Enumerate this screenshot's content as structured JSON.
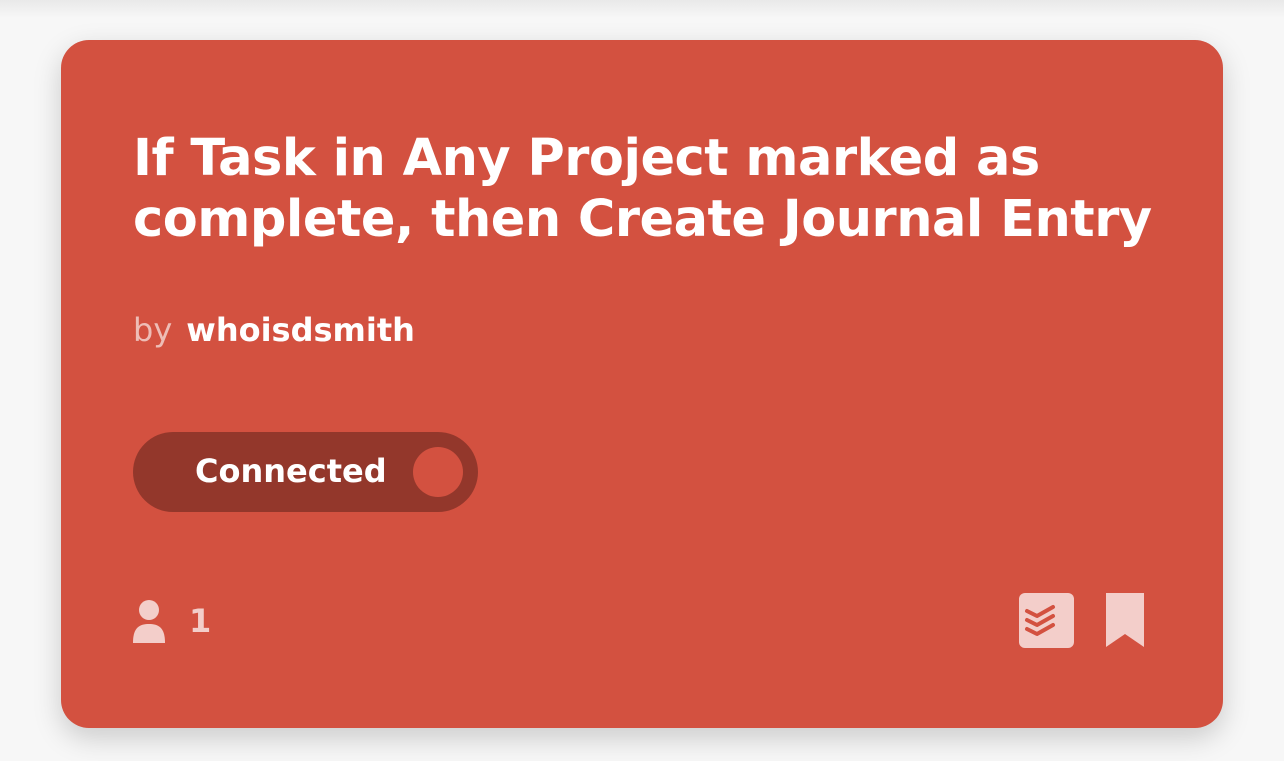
{
  "card": {
    "title": "If Task in Any Project marked as complete, then Create Journal Entry",
    "by_label": "by",
    "author": "whoisdsmith",
    "toggle": {
      "label": "Connected",
      "state": "on"
    },
    "user_count": "1",
    "icons": {
      "users": "person-icon",
      "service": "todoist-icon",
      "bookmark": "bookmark-icon"
    },
    "colors": {
      "card_background": "#d35140",
      "toggle_background": "#93372b",
      "text": "#ffffff"
    }
  }
}
